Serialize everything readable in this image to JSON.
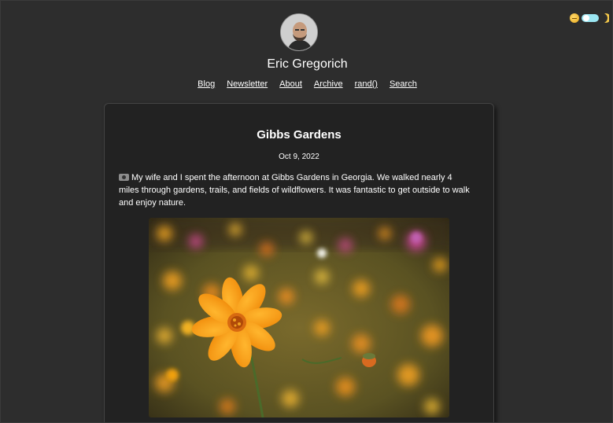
{
  "site": {
    "author_name": "Eric Gregorich"
  },
  "nav": {
    "items": [
      {
        "label": "Blog"
      },
      {
        "label": "Newsletter"
      },
      {
        "label": "About"
      },
      {
        "label": "Archive"
      },
      {
        "label": "rand()"
      },
      {
        "label": "Search"
      }
    ]
  },
  "theme_toggle": {
    "light_icon": "sun-emoji",
    "dark_icon": "moon-emoji",
    "track_color": "#9be6f2"
  },
  "post": {
    "title": "Gibbs Gardens",
    "date": "Oct 9, 2022",
    "body_icon": "camera-icon",
    "body": "My wife and I spent the afternoon at Gibbs Gardens in Georgia. We walked nearly 4 miles through gardens, trails, and fields of wildflowers. It was fantastic to get outside to walk and enjoy nature."
  },
  "colors": {
    "background": "#2d2d2d",
    "card_background": "#222222",
    "text": "#ffffff"
  }
}
